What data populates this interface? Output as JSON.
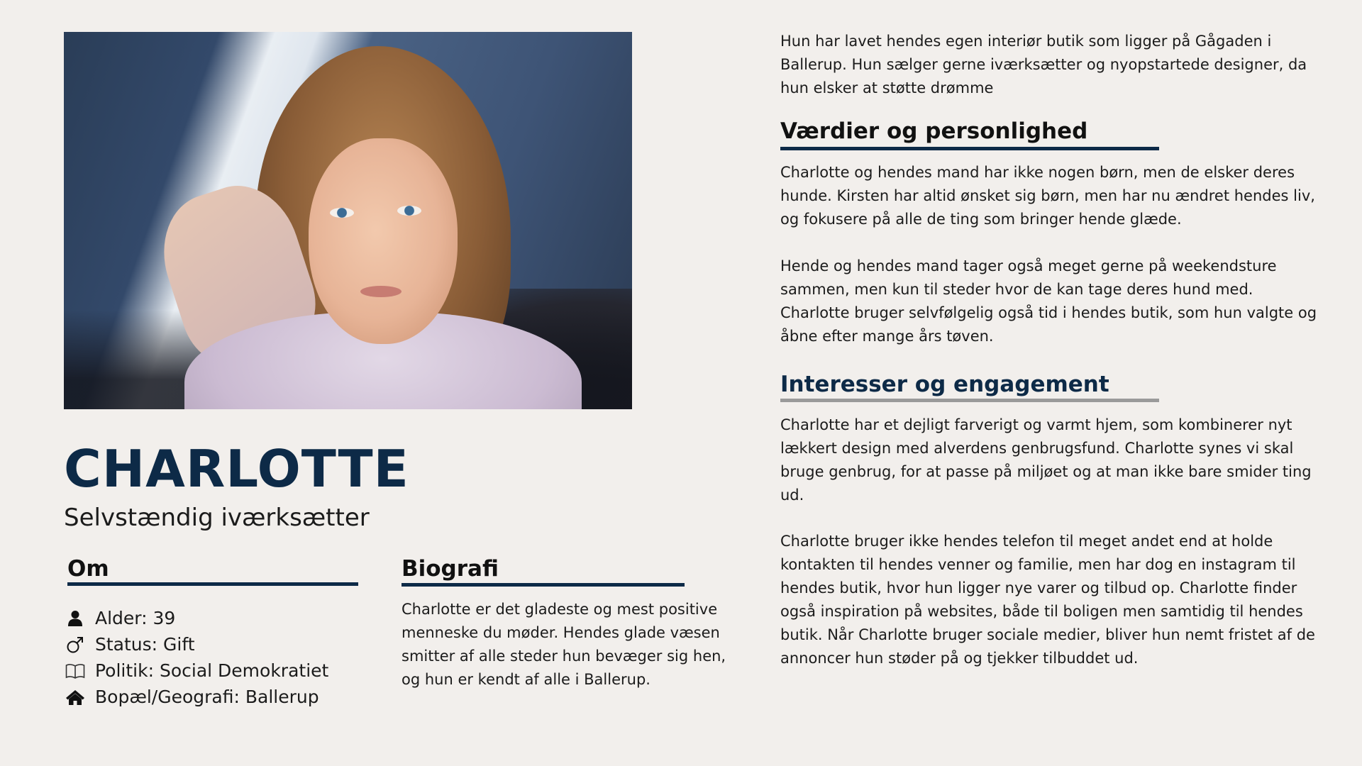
{
  "profile": {
    "name": "CHARLOTTE",
    "subtitle": "Selvstændig iværksætter"
  },
  "about": {
    "heading": "Om",
    "items": [
      {
        "icon": "person-icon",
        "text": "Alder: 39"
      },
      {
        "icon": "male-symbol-icon",
        "text": "Status: Gift"
      },
      {
        "icon": "open-book-icon",
        "text": "Politik: Social Demokratiet"
      },
      {
        "icon": "home-icon",
        "text": "Bopæl/Geografi: Ballerup"
      }
    ]
  },
  "biography": {
    "heading": "Biografi",
    "text": "Charlotte er det gladeste og mest positive menneske du møder. Hendes glade væsen smitter af alle steder hun bevæger sig hen, og hun er kendt af alle i Ballerup."
  },
  "intro": {
    "text": "Hun har lavet hendes egen interiør butik som ligger på Gågaden i Ballerup. Hun sælger gerne iværksætter og nyopstartede designer, da hun elsker at støtte drømme"
  },
  "values": {
    "heading": "Værdier og personlighed",
    "paragraph_1": "Charlotte og hendes mand har ikke nogen børn, men de elsker deres hunde. Kirsten har altid ønsket sig børn, men har nu ændret hendes liv, og fokusere på alle de ting som bringer hende glæde.",
    "paragraph_2": "Hende og hendes mand tager også meget gerne på weekendsture sammen, men kun til steder hvor de kan tage deres hund med. Charlotte bruger selvfølgelig også tid i hendes butik, som hun valgte og åbne efter mange års tøven."
  },
  "interests": {
    "heading": "Interesser og engagement",
    "paragraph_1": "Charlotte har et dejligt farverigt og varmt hjem, som kombinerer nyt lækkert design med alverdens genbrugsfund. Charlotte synes vi skal bruge genbrug, for at passe på miljøet og at man ikke bare smider ting ud.",
    "paragraph_2": "Charlotte bruger ikke hendes telefon til meget andet end at holde kontakten til hendes venner og familie, men har dog en instagram til hendes butik, hvor hun ligger nye varer og tilbud op. Charlotte finder også inspiration på websites, både til boligen men samtidig til hendes butik. Når Charlotte bruger sociale medier, bliver hun nemt fristet af de annoncer hun støder på og tjekker tilbuddet ud."
  },
  "colors": {
    "navy": "#0d2a47",
    "background": "#f2efec",
    "rule_gray": "#9a9a9a"
  }
}
